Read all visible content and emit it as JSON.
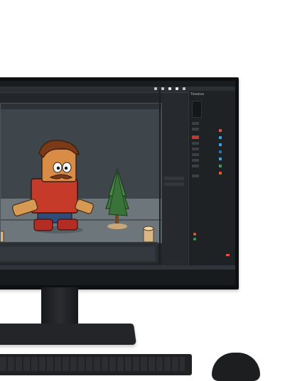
{
  "app": {
    "title": "",
    "tab_label": "",
    "toolbar_buttons": [
      "",
      ""
    ],
    "panel_title": "Timeline",
    "status_line": "",
    "mid_labels": [
      "",
      "",
      ""
    ],
    "rows": [
      {
        "label": "",
        "color": "#d9534f"
      },
      {
        "label": "",
        "color": "#3aa0e6"
      },
      {
        "label": "",
        "color": "#3aa0e6"
      },
      {
        "label": "",
        "color": "#2f6fa8"
      },
      {
        "label": "",
        "color": "#3aa0e6"
      },
      {
        "label": "",
        "color": "#3a9a58"
      },
      {
        "label": "",
        "color": "#e2551e"
      }
    ],
    "prop_labels": [
      "",
      "",
      "",
      ""
    ]
  },
  "colors": {
    "accent": "#e35b2a",
    "blue": "#3aa0e6"
  }
}
